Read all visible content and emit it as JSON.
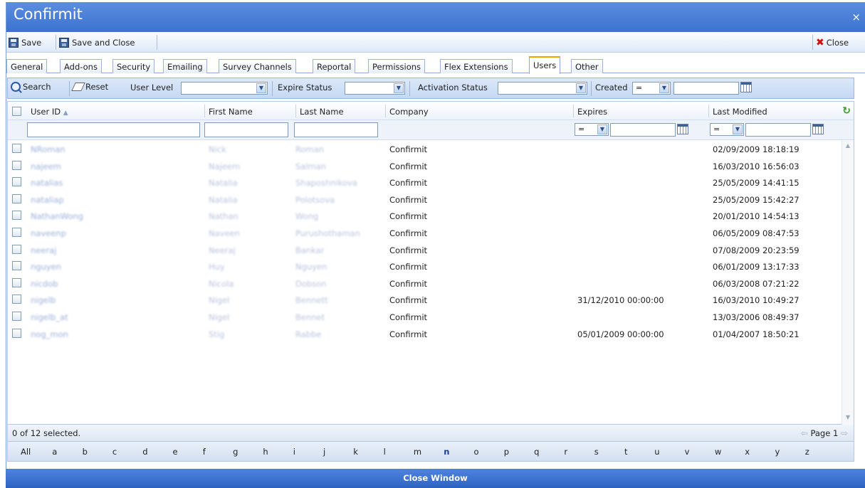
{
  "window": {
    "title": "Confirmit",
    "close_glyph": "×"
  },
  "toolbar": {
    "save": "Save",
    "save_and_close": "Save and Close",
    "close": "Close"
  },
  "tabs": [
    "General",
    "Add-ons",
    "Security",
    "Emailing",
    "Survey Channels",
    "Reportal",
    "Permissions",
    "Flex Extensions",
    "Users",
    "Other"
  ],
  "active_tab": "Users",
  "filters": {
    "search": "Search",
    "reset": "Reset",
    "user_level": "User Level",
    "expire_status": "Expire Status",
    "activation_status": "Activation Status",
    "created": "Created",
    "created_op": "="
  },
  "grid": {
    "headers": {
      "user_id": "User ID",
      "sort_indicator": "▲",
      "first_name": "First Name",
      "last_name": "Last Name",
      "company": "Company",
      "expires": "Expires",
      "last_modified": "Last Modified"
    },
    "expires_op": "=",
    "modified_op": "=",
    "rows": [
      {
        "user_id": "NRoman",
        "first_name": "Nick",
        "last_name": "Roman",
        "company": "Confirmit",
        "expires": "",
        "last_modified": "02/09/2009 18:18:19"
      },
      {
        "user_id": "najeem",
        "first_name": "Najeem",
        "last_name": "Salman",
        "company": "Confirmit",
        "expires": "",
        "last_modified": "16/03/2010 16:56:03"
      },
      {
        "user_id": "natalias",
        "first_name": "Natalia",
        "last_name": "Shaposhnikova",
        "company": "Confirmit",
        "expires": "",
        "last_modified": "25/05/2009 14:41:15"
      },
      {
        "user_id": "nataliap",
        "first_name": "Natalia",
        "last_name": "Polotsova",
        "company": "Confirmit",
        "expires": "",
        "last_modified": "25/05/2009 15:42:27"
      },
      {
        "user_id": "NathanWong",
        "first_name": "Nathan",
        "last_name": "Wong",
        "company": "Confirmit",
        "expires": "",
        "last_modified": "20/01/2010 14:54:13"
      },
      {
        "user_id": "naveenp",
        "first_name": "Naveen",
        "last_name": "Purushothaman",
        "company": "Confirmit",
        "expires": "",
        "last_modified": "06/05/2009 08:47:53"
      },
      {
        "user_id": "neeraj",
        "first_name": "Neeraj",
        "last_name": "Bankar",
        "company": "Confirmit",
        "expires": "",
        "last_modified": "07/08/2009 20:23:59"
      },
      {
        "user_id": "nguyen",
        "first_name": "Huy",
        "last_name": "Nguyen",
        "company": "Confirmit",
        "expires": "",
        "last_modified": "06/01/2009 13:17:33"
      },
      {
        "user_id": "nicdob",
        "first_name": "Nicola",
        "last_name": "Dobson",
        "company": "Confirmit",
        "expires": "",
        "last_modified": "06/03/2008 07:21:22"
      },
      {
        "user_id": "nigelb",
        "first_name": "Nigel",
        "last_name": "Bennett",
        "company": "Confirmit",
        "expires": "31/12/2010 00:00:00",
        "last_modified": "16/03/2010 10:49:27"
      },
      {
        "user_id": "nigelb_at",
        "first_name": "Nigel",
        "last_name": "Bennet",
        "company": "Confirmit",
        "expires": "",
        "last_modified": "13/03/2006 08:49:37"
      },
      {
        "user_id": "nog_mon",
        "first_name": "Stig",
        "last_name": "Rabbe",
        "company": "Confirmit",
        "expires": "05/01/2009 00:00:00",
        "last_modified": "01/04/2007 18:50:21"
      }
    ]
  },
  "status": {
    "selected": "0 of 12 selected.",
    "page": "Page 1"
  },
  "alphabet": [
    "All",
    "a",
    "b",
    "c",
    "d",
    "e",
    "f",
    "g",
    "h",
    "i",
    "j",
    "k",
    "l",
    "m",
    "n",
    "o",
    "p",
    "q",
    "r",
    "s",
    "t",
    "u",
    "v",
    "w",
    "x",
    "y",
    "z"
  ],
  "alphabet_selected": "n",
  "footer": {
    "close_window": "Close Window"
  },
  "colors": {
    "title_bar": "#3d72cf",
    "tab_accent": "#f0a400",
    "link_blur": "#9bb0d8",
    "footer": "#2f63c3"
  }
}
